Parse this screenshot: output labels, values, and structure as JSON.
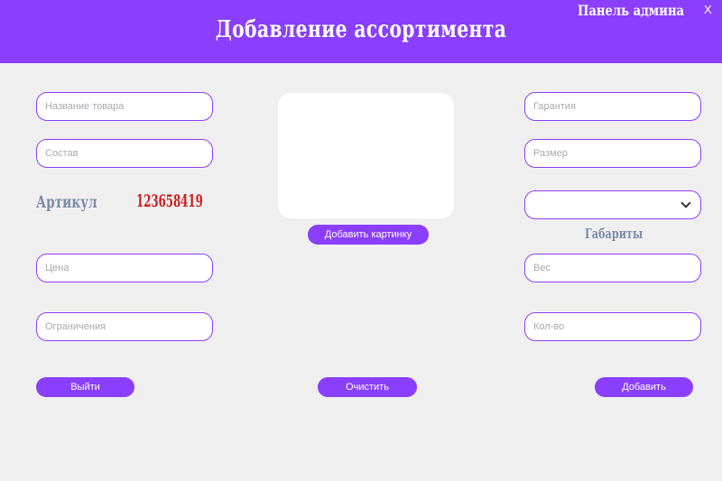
{
  "header": {
    "title": "Добавление ассортимента",
    "admin_link": "Панель админа",
    "close_label": "X"
  },
  "left": {
    "name_placeholder": "Название товара",
    "composition_placeholder": "Состав",
    "article_label": "Артикул",
    "article_value": "123658419",
    "price_placeholder": "Цена",
    "restrictions_placeholder": "Ограничения"
  },
  "center": {
    "add_image_label": "Добавить картинку"
  },
  "right": {
    "warranty_placeholder": "Гарантия",
    "size_placeholder": "Размер",
    "dimensions_selected": "",
    "dimensions_label": "Габариты",
    "weight_placeholder": "Вес",
    "quantity_placeholder": "Кол-во"
  },
  "footer": {
    "exit_label": "Выйти",
    "clear_label": "Очистить",
    "add_label": "Добавить"
  },
  "colors": {
    "accent": "#8a3ffc",
    "background": "#efeff0",
    "label": "#7d8aa8",
    "article_value": "#d11a1a"
  }
}
